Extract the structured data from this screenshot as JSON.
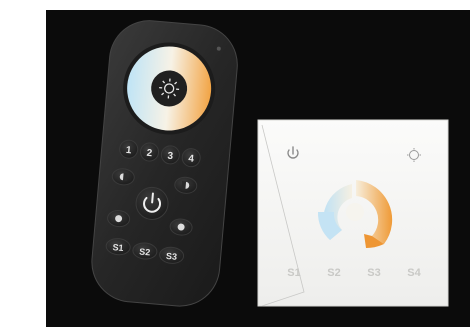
{
  "remote": {
    "zone_keys": [
      "1",
      "2",
      "3",
      "4"
    ],
    "scene_keys": [
      "S1",
      "S2",
      "S3"
    ],
    "power_icon": "power-icon",
    "center_icon": "sun-icon"
  },
  "wall_panel": {
    "power_icon": "power-icon",
    "brightness_icon": "sun-icon",
    "scene_keys": [
      "S1",
      "S2",
      "S3",
      "S4"
    ]
  },
  "colors": {
    "background": "#ffffff",
    "backdrop": "#0b0b0b",
    "remote_body": "#2a2a2a",
    "panel_glass": "#f4f4f2",
    "warm": "#f1a64a",
    "cool": "#bfe0f2"
  }
}
